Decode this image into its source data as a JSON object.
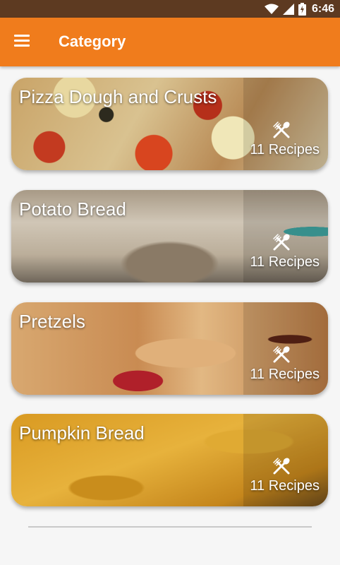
{
  "status": {
    "time": "6:46"
  },
  "appbar": {
    "title": "Category"
  },
  "categories": [
    {
      "name": "Pizza Dough and Crusts",
      "count": "11 Recipes"
    },
    {
      "name": "Potato Bread",
      "count": "11 Recipes"
    },
    {
      "name": "Pretzels",
      "count": "11 Recipes"
    },
    {
      "name": "Pumpkin Bread",
      "count": "11 Recipes"
    }
  ],
  "icons": {
    "menu": "hamburger-menu-icon",
    "recipes": "fork-spoon-icon",
    "wifi": "wifi-icon",
    "signal": "cell-signal-icon",
    "battery": "battery-icon"
  },
  "colors": {
    "appbar": "#f07c1c",
    "statusbar": "#5d3a21"
  }
}
